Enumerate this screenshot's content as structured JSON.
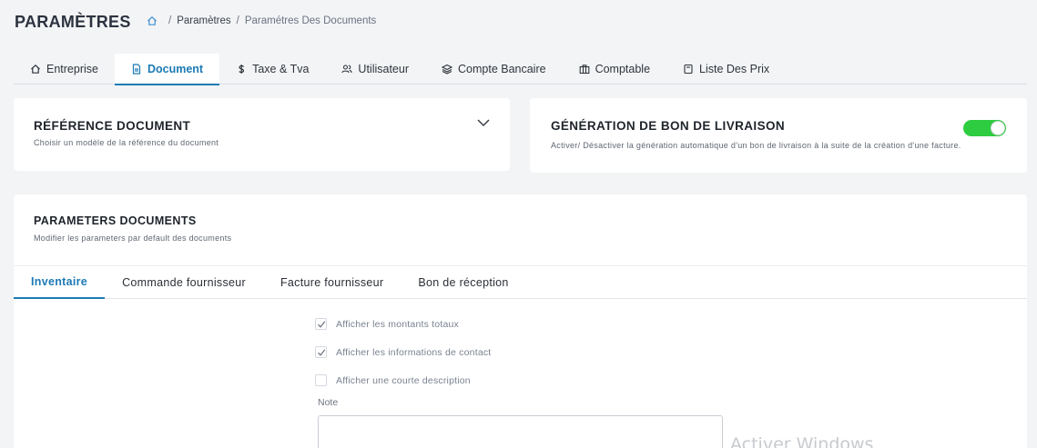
{
  "header": {
    "title": "PARAMÈTRES",
    "breadcrumb": {
      "home_icon": "home-icon",
      "sep": "/",
      "link": "Paramètres",
      "current": "Paramétres Des Documents"
    }
  },
  "top_tabs": [
    {
      "label": "Entreprise",
      "icon": "home-icon"
    },
    {
      "label": "Document",
      "icon": "document-icon",
      "active": true
    },
    {
      "label": "Taxe & Tva",
      "icon": "dollar-icon"
    },
    {
      "label": "Utilisateur",
      "icon": "users-icon"
    },
    {
      "label": "Compte Bancaire",
      "icon": "layers-icon"
    },
    {
      "label": "Comptable",
      "icon": "briefcase-icon"
    },
    {
      "label": "Liste Des Prix",
      "icon": "tag-icon"
    }
  ],
  "reference_card": {
    "title": "RÉFÉRENCE DOCUMENT",
    "subtitle": "Choisir un modèle de la référence du document"
  },
  "generation_card": {
    "title": "GÉNÉRATION DE BON DE LIVRAISON",
    "subtitle": "Activer/ Désactiver la génération automatique d'un bon de livraison à la suite de la création d'une facture.",
    "toggle_on": true,
    "toggle_color": "#2ecc40"
  },
  "params_card": {
    "title": "PARAMETERS DOCUMENTS",
    "subtitle": "Modifier les parameters par default des documents",
    "tabs": [
      "Inventaire",
      "Commande fournisseur",
      "Facture fournisseur",
      "Bon de réception"
    ],
    "active_tab": "Inventaire",
    "options": [
      {
        "label": "Afficher les montants totaux",
        "checked": true
      },
      {
        "label": "Afficher les informations de contact",
        "checked": true
      },
      {
        "label": "Afficher une courte description",
        "checked": false
      }
    ],
    "note_label": "Note",
    "note_value": ""
  },
  "watermark": "Activer Windows",
  "colors": {
    "accent": "#1c7ab5",
    "background": "#f3f4f6"
  }
}
